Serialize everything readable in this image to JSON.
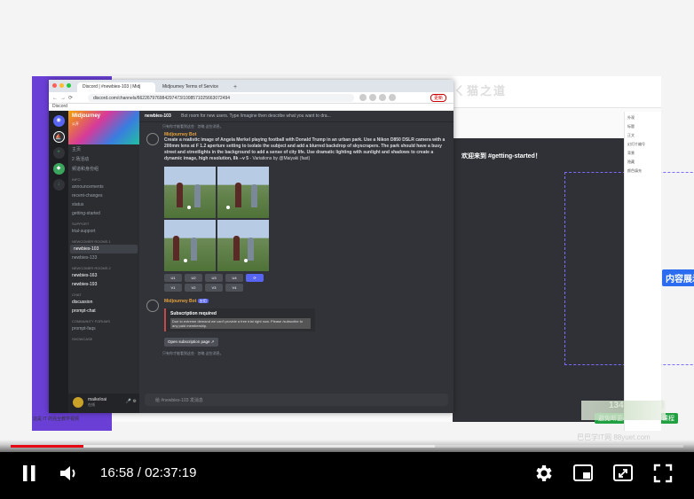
{
  "colors": {
    "accent": "#e50914",
    "discord_bg": "#313338",
    "blurple": "#5865f2",
    "tag_blue": "#2c6cf0",
    "frame_purple": "#6a3fd6"
  },
  "browser": {
    "tabs": [
      {
        "label": "Discord | #newbies-103 | Midj"
      },
      {
        "label": "Midjourney Terms of Service"
      }
    ],
    "url": "discord.com/channels/662267976984297473/1008571025663072494",
    "update_label": "更新"
  },
  "bookmark": {
    "label": "Discord"
  },
  "discord": {
    "server_name": "Midjourney",
    "server_status": "公开",
    "channel_name": "newbies-103",
    "topic": "Bot room for new users. Type /imagine then describe what you want to dra...",
    "sidebar": {
      "top_items": [
        "主页",
        "2 场活动",
        "频道和身份组"
      ],
      "cat_info": "INFO",
      "info": [
        "announcements",
        "recent-changes",
        "status",
        "getting-started"
      ],
      "cat_support": "SUPPORT",
      "support": [
        "trial-support"
      ],
      "cat_n1": "NEWCOMER ROOMS 1",
      "n1": [
        "newbies-103",
        "newbies-133"
      ],
      "cat_n2": "NEWCOMER ROOMS 2",
      "n2": [
        "newbies-163",
        "newbies-193"
      ],
      "cat_chat": "CHAT",
      "chat": [
        "discussion",
        "prompt-chat"
      ],
      "cat_community": "COMMUNITY FORUMS",
      "community": [
        "prompt-faqs"
      ],
      "cat_showcase": "SHOWCASE"
    },
    "user": {
      "name": "maikeloai",
      "status": "在线"
    },
    "messages": {
      "sys1": "只有你才能看到这些 · 忽略 这些消息。",
      "m1_author": "Midjourney Bot",
      "m1_prompt": "Create a realistic image of Angela Merkel playing football with Donald Trump in an urban park. Use a Nikon D850 DSLR camera with a 200mm lens at F 1.2 aperture setting to isolate the subject and add a blurred backdrop of skyscrapers. The park should have a busy street and streetlights in the background to add a sense of city life. Use dramatic lighting with sunlight and shadows to create a dynamic image, high resolution, 8k --v 5",
      "m1_suffix": "- Variations by @Maiyaki (fast)",
      "upscale_buttons": [
        "U1",
        "U2",
        "U3",
        "U4"
      ],
      "variation_buttons": [
        "V1",
        "V2",
        "V3",
        "V4"
      ],
      "m2_author": "Midjourney Bot",
      "m2_tag": "应用",
      "embed_title": "Subscription required",
      "embed_desc": "Due to extreme demand we can't provide a free trial right now. Please /subscribe to any paid membership.",
      "link_button": "Open subscription page",
      "sys2": "只有你才能看到这些 · 忽略 这些消息。"
    },
    "composer_placeholder": "给 #newbies-103 发消息"
  },
  "right_app": {
    "heading": "欢迎来到 #getting-started！",
    "callout": "内容展示区",
    "phone": "13457856568",
    "promo": "避免断更/更多最新低价课程",
    "inspector": [
      "外观",
      "标题",
      "正文",
      "幻灯片编号",
      "背景",
      "隐藏",
      "颜色填充"
    ]
  },
  "bg_title": "ㄑ猫之道",
  "caption": "这是 IT 的完全教学视频",
  "watermark": "巴巴学IT网 88yuet.com",
  "player": {
    "current_time": "16:58",
    "duration": "02:37:19",
    "progress_played": 0.108,
    "progress_loaded": 0.63
  }
}
